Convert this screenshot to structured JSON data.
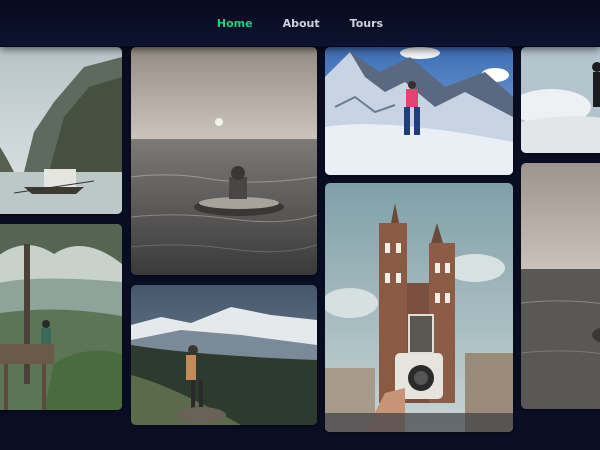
{
  "nav": {
    "items": [
      {
        "label": "Home",
        "active": true
      },
      {
        "label": "About",
        "active": false
      },
      {
        "label": "Tours",
        "active": false
      }
    ],
    "active_color": "#1fd07b",
    "text_color": "#d0d3dc"
  },
  "gallery": {
    "photos": [
      {
        "name": "photo-limestone-boat"
      },
      {
        "name": "photo-pool-float-sea"
      },
      {
        "name": "photo-hiker-snow"
      },
      {
        "name": "photo-dark-figure-clouds"
      },
      {
        "name": "photo-tree-valley"
      },
      {
        "name": "photo-church-camera"
      },
      {
        "name": "photo-sea-right"
      },
      {
        "name": "photo-mountain-hiker"
      }
    ]
  }
}
